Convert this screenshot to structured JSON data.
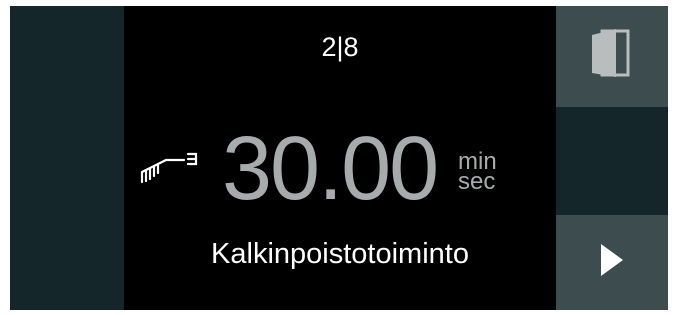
{
  "step_indicator": "2|8",
  "timer": {
    "value": "30.00",
    "unit_top": "min",
    "unit_bottom": "sec"
  },
  "program_name": "Kalkinpoistotoiminto",
  "icons": {
    "tool": "descaling-brush-icon",
    "door": "door-icon",
    "next": "play-arrow-icon"
  },
  "colors": {
    "background": "#000000",
    "side_panel": "#15262a",
    "button": "#3d4d4f",
    "timer_text": "#a8abac",
    "text": "#ffffff"
  }
}
